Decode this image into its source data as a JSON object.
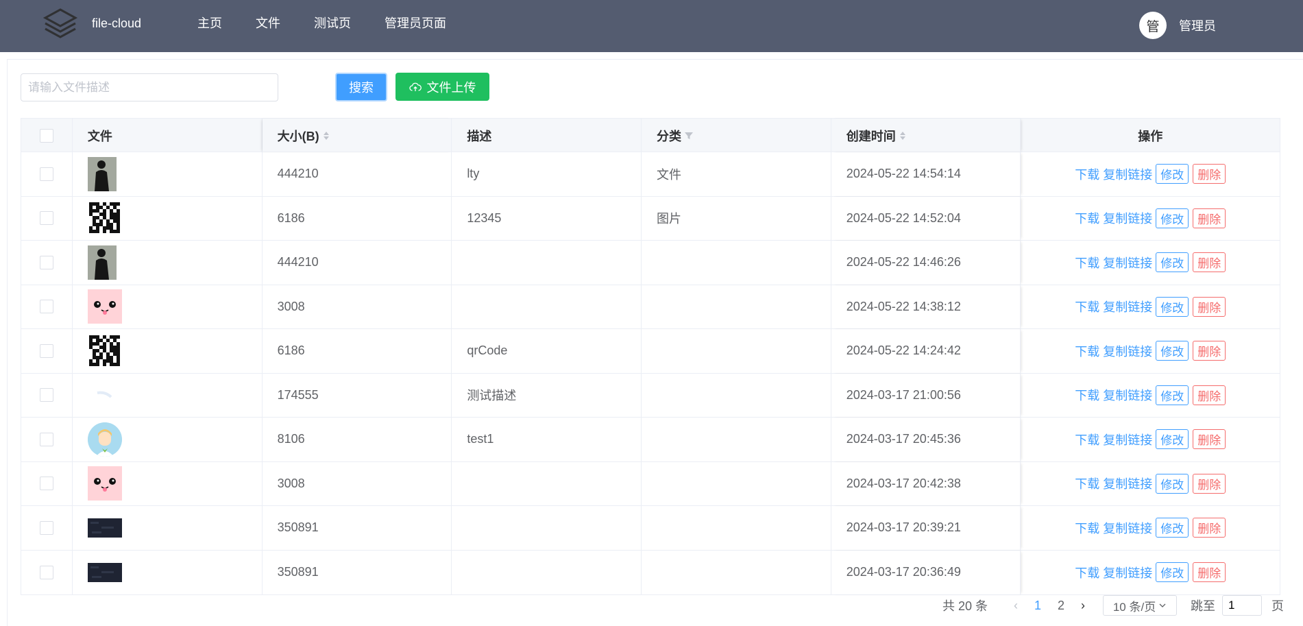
{
  "header": {
    "brand": "file-cloud",
    "nav": [
      "主页",
      "文件",
      "测试页",
      "管理员页面"
    ],
    "avatar_text": "管",
    "user_name": "管理员",
    "bg_color": "#545c70"
  },
  "toolbar": {
    "search_placeholder": "请输入文件描述",
    "search_value": "",
    "search_label": "搜索",
    "upload_label": "文件上传",
    "upload_icon": "cloud-upload-icon"
  },
  "table": {
    "headers": {
      "file": "文件",
      "size": "大小(B)",
      "desc": "描述",
      "category": "分类",
      "created": "创建时间",
      "ops": "操作"
    },
    "rows": [
      {
        "thumb": "silhouette",
        "size": "444210",
        "desc": "lty",
        "category": "文件",
        "created": "2024-05-22 14:54:14"
      },
      {
        "thumb": "qr",
        "size": "6186",
        "desc": "12345",
        "category": "图片",
        "created": "2024-05-22 14:52:04"
      },
      {
        "thumb": "silhouette",
        "size": "444210",
        "desc": "",
        "category": "",
        "created": "2024-05-22 14:46:26"
      },
      {
        "thumb": "pink-face",
        "size": "3008",
        "desc": "",
        "category": "",
        "created": "2024-05-22 14:38:12"
      },
      {
        "thumb": "qr",
        "size": "6186",
        "desc": "qrCode",
        "category": "",
        "created": "2024-05-22 14:24:42"
      },
      {
        "thumb": "blank",
        "size": "174555",
        "desc": "测试描述",
        "category": "",
        "created": "2024-03-17 21:00:56"
      },
      {
        "thumb": "avatar",
        "size": "8106",
        "desc": "test1",
        "category": "",
        "created": "2024-03-17 20:45:36"
      },
      {
        "thumb": "pink-face",
        "size": "3008",
        "desc": "",
        "category": "",
        "created": "2024-03-17 20:42:38"
      },
      {
        "thumb": "dark",
        "size": "350891",
        "desc": "",
        "category": "",
        "created": "2024-03-17 20:39:21"
      },
      {
        "thumb": "dark",
        "size": "350891",
        "desc": "",
        "category": "",
        "created": "2024-03-17 20:36:49"
      }
    ],
    "ops": {
      "download": "下载",
      "copy_link": "复制链接",
      "edit": "修改",
      "delete": "删除"
    }
  },
  "pagination": {
    "total": "共 20 条",
    "pages": [
      "1",
      "2"
    ],
    "current_page": "1",
    "page_size": "10 条/页",
    "jump_label": "跳至",
    "jump_value": "1",
    "page_suffix": "页"
  },
  "colors": {
    "primary": "#409eff",
    "success": "#1fbf5f",
    "danger": "#f56c6c"
  }
}
